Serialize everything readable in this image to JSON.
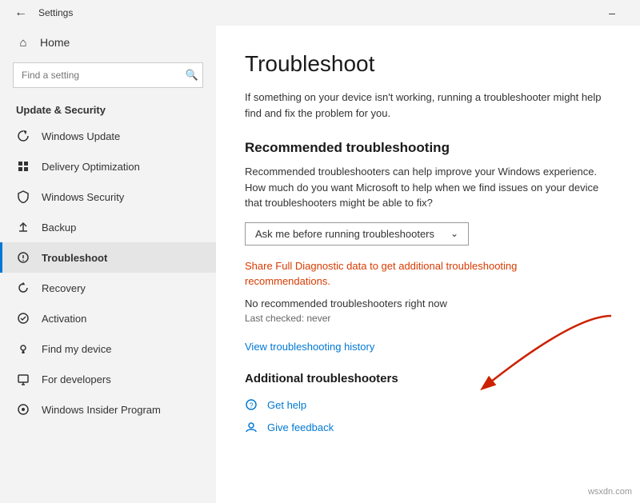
{
  "titlebar": {
    "title": "Settings",
    "minimize_label": "–",
    "back_label": "←"
  },
  "sidebar": {
    "home_label": "Home",
    "search_placeholder": "Find a setting",
    "section_title": "Update & Security",
    "items": [
      {
        "id": "windows-update",
        "label": "Windows Update",
        "icon": "↻",
        "active": false
      },
      {
        "id": "delivery-optimization",
        "label": "Delivery Optimization",
        "icon": "⬇",
        "active": false
      },
      {
        "id": "windows-security",
        "label": "Windows Security",
        "icon": "🛡",
        "active": false
      },
      {
        "id": "backup",
        "label": "Backup",
        "icon": "↑",
        "active": false
      },
      {
        "id": "troubleshoot",
        "label": "Troubleshoot",
        "icon": "⚙",
        "active": true
      },
      {
        "id": "recovery",
        "label": "Recovery",
        "icon": "↺",
        "active": false
      },
      {
        "id": "activation",
        "label": "Activation",
        "icon": "✓",
        "active": false
      },
      {
        "id": "find-my-device",
        "label": "Find my device",
        "icon": "⊕",
        "active": false
      },
      {
        "id": "for-developers",
        "label": "For developers",
        "icon": "⊞",
        "active": false
      },
      {
        "id": "windows-insider",
        "label": "Windows Insider Program",
        "icon": "◎",
        "active": false
      }
    ]
  },
  "content": {
    "title": "Troubleshoot",
    "description": "If something on your device isn't working, running a troubleshooter might help find and fix the problem for you.",
    "recommended_section": {
      "title": "Recommended troubleshooting",
      "description": "Recommended troubleshooters can help improve your Windows experience. How much do you want Microsoft to help when we find issues on your device that troubleshooters might be able to fix?",
      "dropdown_value": "Ask me before running troubleshooters",
      "diagnostic_link": "Share Full Diagnostic data to get additional troubleshooting recommendations.",
      "no_troubleshooters": "No recommended troubleshooters right now",
      "last_checked": "Last checked: never"
    },
    "view_history_link": "View troubleshooting history",
    "additional_section": {
      "title": "Additional troubleshooters"
    },
    "help_links": [
      {
        "id": "get-help",
        "label": "Get help",
        "icon": "💬"
      },
      {
        "id": "give-feedback",
        "label": "Give feedback",
        "icon": "👤"
      }
    ]
  },
  "watermark": "wsxdn.com"
}
